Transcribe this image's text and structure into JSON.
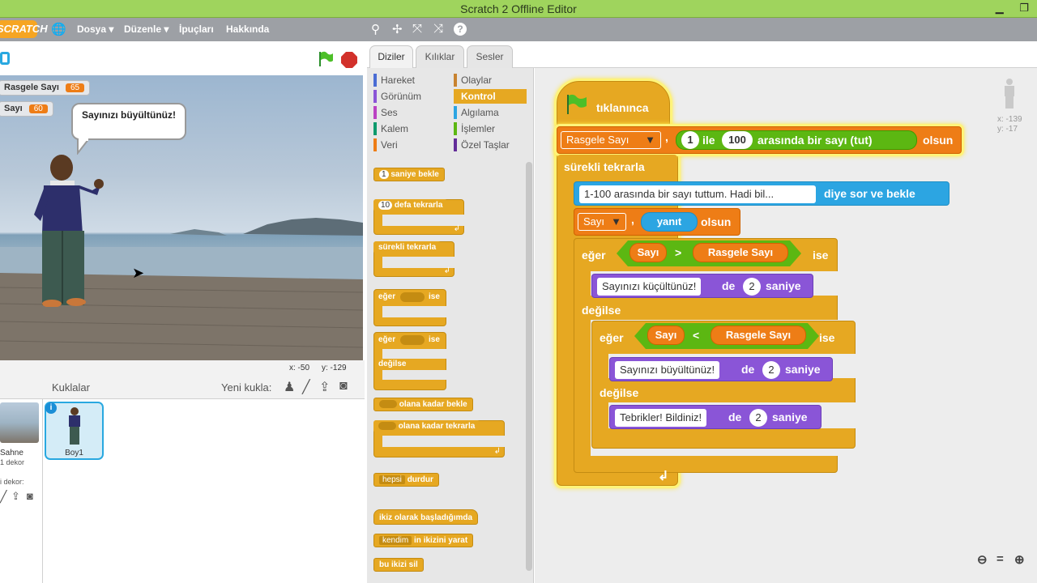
{
  "window": {
    "title": "Scratch 2 Offline Editor"
  },
  "menubar": {
    "logo": "SCRATCH",
    "items": [
      "Dosya ▾",
      "Düzenle ▾",
      "İpuçları",
      "Hakkında"
    ]
  },
  "stage": {
    "monitors": [
      {
        "label": "Rasgele Sayı",
        "value": "65"
      },
      {
        "label": "Sayı",
        "value": "60"
      }
    ],
    "bubble": "Sayınızı büyültünüz!",
    "mouse_x": "x: -50",
    "mouse_y": "y: -129"
  },
  "sprites": {
    "header": "Kuklalar",
    "new_sprite": "Yeni kukla:",
    "stage_label": "Sahne",
    "stage_sub": "1 dekor",
    "new_backdrop": "i dekor:",
    "sprite1": "Boy1"
  },
  "tabs": [
    "Diziler",
    "Kılıklar",
    "Sesler"
  ],
  "categories": {
    "left": [
      {
        "label": "Hareket",
        "color": "#4a6cd4"
      },
      {
        "label": "Görünüm",
        "color": "#8a55d7"
      },
      {
        "label": "Ses",
        "color": "#bb42c3"
      },
      {
        "label": "Kalem",
        "color": "#0e9a6c"
      },
      {
        "label": "Veri",
        "color": "#ee7d16"
      }
    ],
    "right": [
      {
        "label": "Olaylar",
        "color": "#c88330"
      },
      {
        "label": "Kontrol",
        "color": "#e6a822"
      },
      {
        "label": "Algılama",
        "color": "#2ca5e2"
      },
      {
        "label": "İşlemler",
        "color": "#5cb712"
      },
      {
        "label": "Özel Taşlar",
        "color": "#632d99"
      }
    ]
  },
  "palette": {
    "wait": "saniye bekle",
    "wait_num": "1",
    "repeat": "defa tekrarla",
    "repeat_num": "10",
    "forever": "sürekli tekrarla",
    "if": "eğer",
    "then": "ise",
    "if2": "eğer",
    "then2": "ise",
    "else": "değilse",
    "wait_until": "olana kadar bekle",
    "repeat_until": "olana kadar tekrarla",
    "stop_dd": "hepsi",
    "stop": "durdur",
    "clone_start": "ikiz olarak başladığımda",
    "clone_dd": "kendim",
    "clone_create": "in ikizini yarat",
    "clone_delete": "bu ikizi sil"
  },
  "script": {
    "hat": "tıklanınca",
    "set_var": "Rasgele Sayı",
    "from": "1",
    "ile": "ile",
    "to": "100",
    "random_text": "arasında bir sayı (tut)",
    "olsun": "olsun",
    "forever": "sürekli tekrarla",
    "ask_text": "1-100 arasında bir sayı tuttum. Hadi bil...",
    "ask_label": "diye sor ve bekle",
    "set2_var": "Sayı",
    "answer": "yanıt",
    "olsun2": "olsun",
    "if1": "eğer",
    "cmp1_left": "Sayı",
    "cmp1_op": ">",
    "cmp1_right": "Rasgele Sayı",
    "ise1": "ise",
    "say1_text": "Sayınızı küçültünüz!",
    "de": "de",
    "say1_secs": "2",
    "saniye": "saniye",
    "else1": "değilse",
    "if2": "eğer",
    "cmp2_left": "Sayı",
    "cmp2_op": "<",
    "cmp2_right": "Rasgele Sayı",
    "ise2": "ise",
    "say2_text": "Sayınızı büyültünüz!",
    "say2_secs": "2",
    "else2": "değilse",
    "say3_text": "Tebrikler! Bildiniz!",
    "say3_secs": "2"
  },
  "sprite_info": {
    "x": "x: -139",
    "y": "y: -17"
  }
}
